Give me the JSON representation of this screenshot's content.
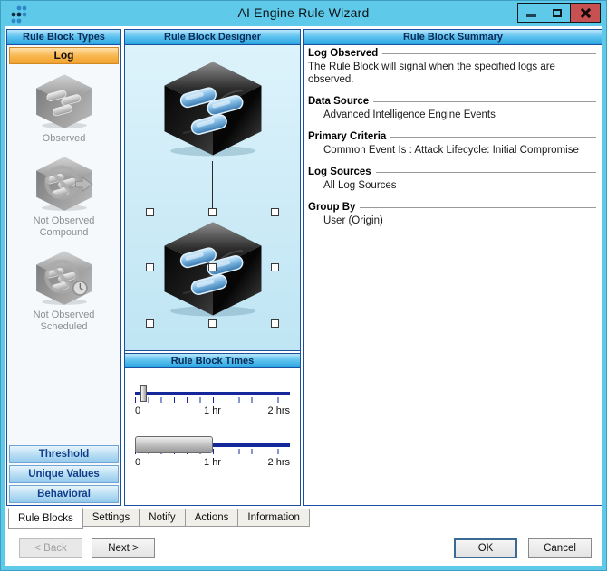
{
  "window": {
    "title": "AI Engine Rule Wizard"
  },
  "panels": {
    "types": {
      "header": "Rule Block Types",
      "selected_type": "Log",
      "items": [
        {
          "line1": "Observed",
          "line2": ""
        },
        {
          "line1": "Not Observed",
          "line2": "Compound"
        },
        {
          "line1": "Not Observed",
          "line2": "Scheduled"
        }
      ],
      "buttons": [
        "Threshold",
        "Unique Values",
        "Behavioral"
      ]
    },
    "designer": {
      "header": "Rule Block Designer"
    },
    "times": {
      "header": "Rule Block Times",
      "slider1": {
        "labels": [
          "0",
          "1 hr",
          "2 hrs"
        ],
        "value": "0"
      },
      "slider2": {
        "labels": [
          "0",
          "1 hr",
          "2 hrs"
        ],
        "range": "0 to 1 hr"
      }
    },
    "summary": {
      "header": "Rule Block Summary",
      "sections": [
        {
          "heading": "Log Observed",
          "text": "The Rule Block will signal when the specified logs are observed."
        },
        {
          "heading": "Data Source",
          "text": "Advanced Intelligence Engine Events"
        },
        {
          "heading": "Primary Criteria",
          "text": "Common Event Is : Attack Lifecycle: Initial Compromise"
        },
        {
          "heading": "Log Sources",
          "text": "All Log Sources"
        },
        {
          "heading": "Group By",
          "text": "User (Origin)"
        }
      ]
    }
  },
  "tabs": [
    {
      "label": "Rule Blocks"
    },
    {
      "label": "Settings"
    },
    {
      "label": "Notify"
    },
    {
      "label": "Actions"
    },
    {
      "label": "Information"
    }
  ],
  "wizard_buttons": {
    "back": "< Back",
    "next": "Next >",
    "ok": "OK",
    "cancel": "Cancel"
  },
  "colors": {
    "titlebar": "#5FC9E9",
    "close_button": "#C75050",
    "selected_type_orange": "#F2A12E",
    "header_blue": "#27A5E0",
    "slider_track_navy": "#14289B",
    "pill_blue": "#5A9FD4"
  }
}
